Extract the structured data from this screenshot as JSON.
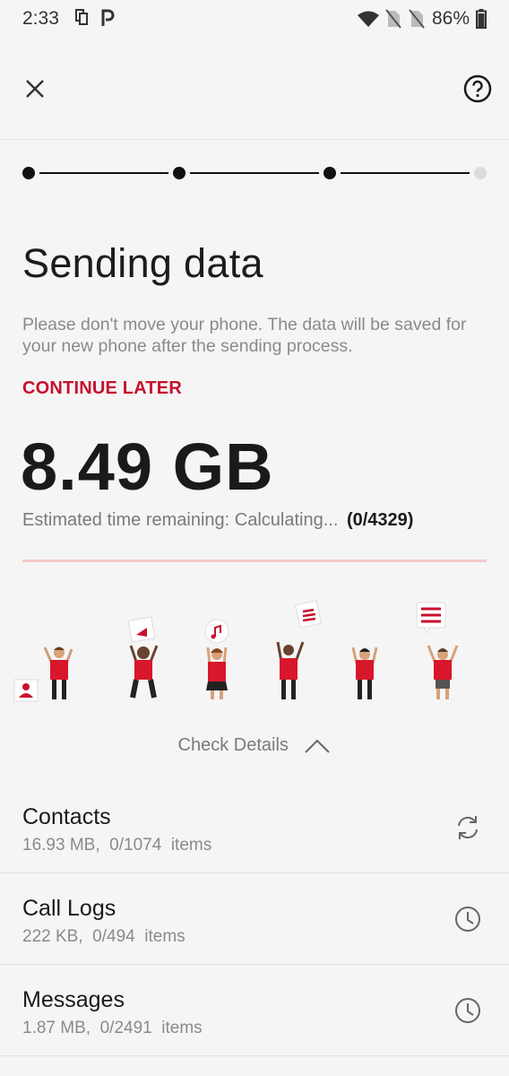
{
  "status_bar": {
    "time": "2:33",
    "battery": "86%",
    "icons": [
      "copy-icon",
      "p-icon",
      "wifi-icon",
      "no-sim-icon",
      "no-sim-icon",
      "battery-icon"
    ]
  },
  "appbar": {
    "close_icon": "close-icon",
    "help_icon": "help-icon"
  },
  "stepper": {
    "total_steps": 4,
    "completed_steps": 3
  },
  "main": {
    "title": "Sending data",
    "description": "Please don't move your phone. The data will be saved for your new phone after the sending process.",
    "continue_later": "CONTINUE LATER",
    "size": "8.49 GB",
    "eta_label": "Estimated time remaining: Calculating...",
    "eta_count": "(0/4329)",
    "progress": 0
  },
  "check_details": {
    "label": "Check Details",
    "icon": "chevron-up-icon"
  },
  "items": [
    {
      "title": "Contacts",
      "subtitle": "16.93 MB,  0/1074  items",
      "icon": "sync-icon"
    },
    {
      "title": "Call Logs",
      "subtitle": "222 KB,  0/494  items",
      "icon": "clock-icon"
    },
    {
      "title": "Messages",
      "subtitle": "1.87 MB,  0/2491  items",
      "icon": "clock-icon"
    }
  ],
  "colors": {
    "accent": "#c8102e",
    "progress_track": "#f3c9c9",
    "background": "#f5f5f5"
  }
}
